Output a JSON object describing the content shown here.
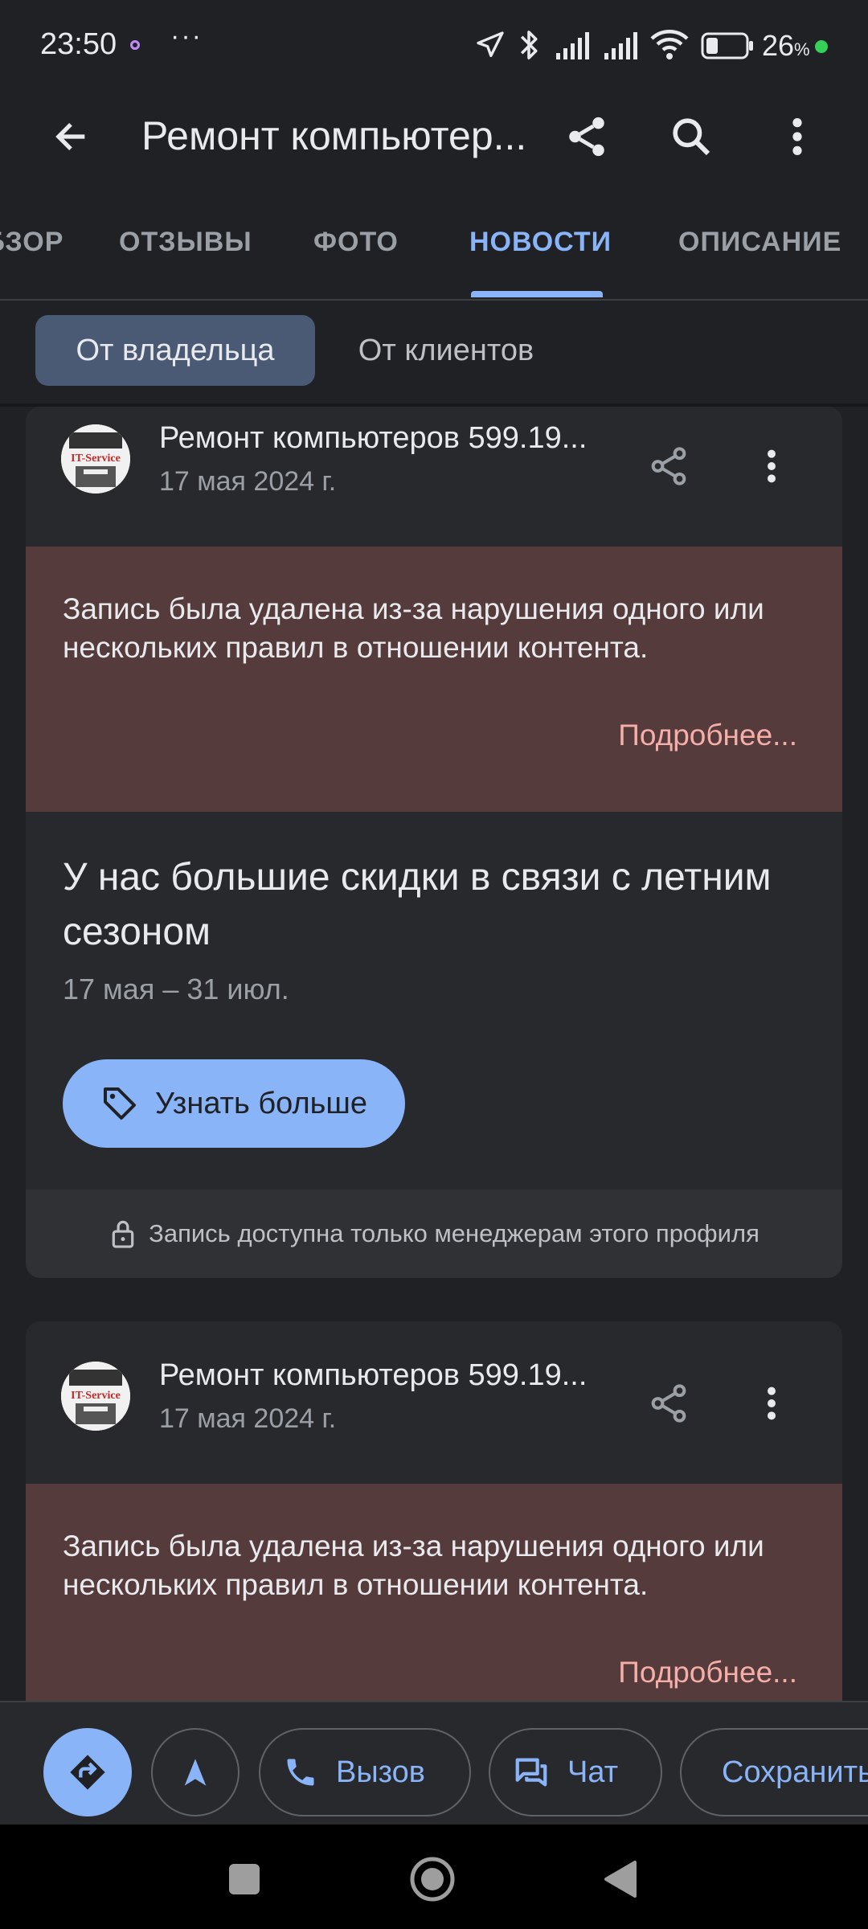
{
  "status_bar": {
    "time": "23:50",
    "more": "···",
    "battery": "26",
    "battery_unit": "%"
  },
  "app_bar": {
    "title": "Ремонт компьютер..."
  },
  "tabs": [
    {
      "label": "ОБЗОР"
    },
    {
      "label": "ОТЗЫВЫ"
    },
    {
      "label": "ФОТО"
    },
    {
      "label": "НОВОСТИ"
    },
    {
      "label": "ОПИСАНИЕ"
    }
  ],
  "filters": {
    "owner": "От владельца",
    "clients": "От клиентов"
  },
  "posts": [
    {
      "name": "Ремонт компьютеров 599.19...",
      "date": "17 мая 2024 г.",
      "removed_text": "Запись была удалена из-за нарушения одного или нескольких правил в отношении контента.",
      "more_link": "Подробнее...",
      "offer_title": "У нас большие скидки в связи с летним сезоном",
      "offer_dates": "17 мая – 31 июл.",
      "cta": "Узнать больше",
      "footer_note": "Запись доступна только менеджерам этого профиля"
    },
    {
      "name": "Ремонт компьютеров 599.19...",
      "date": "17 мая 2024 г.",
      "removed_text": "Запись была удалена из-за нарушения одного или нескольких правил в отношении контента.",
      "more_link": "Подробнее..."
    }
  ],
  "avatar_logo_text": "IT-Service",
  "actions": {
    "call": "Вызов",
    "chat": "Чат",
    "save": "Сохранить"
  },
  "colors": {
    "accent": "#8ab4f8",
    "removed_bg": "#553b3b",
    "link": "#f6aea9",
    "save_icon": "#f28ab4"
  }
}
